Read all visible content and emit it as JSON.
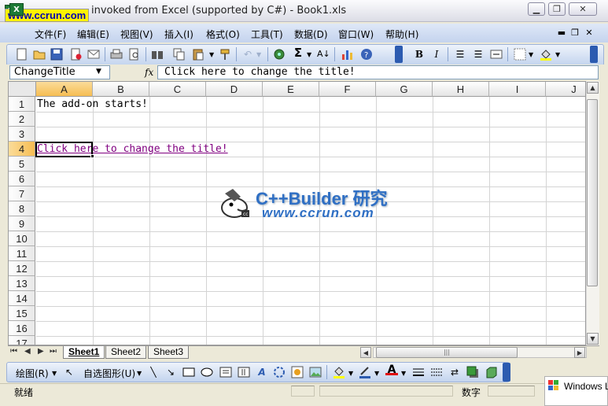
{
  "window": {
    "title": "invoked from Excel (supported by C#) - Book1.xls",
    "watermark_corner": "www.ccrun.com",
    "app_icon_letter": "X",
    "buttons": {
      "minimize": "▁",
      "restore": "❐",
      "close": "✕"
    }
  },
  "menu": {
    "items": [
      "文件(F)",
      "编辑(E)",
      "视图(V)",
      "插入(I)",
      "格式(O)",
      "工具(T)",
      "数据(D)",
      "窗口(W)",
      "帮助(H)"
    ],
    "mdi": {
      "minimize": "▬",
      "restore": "❐",
      "close": "✕"
    }
  },
  "formula_bar": {
    "name_box": "ChangeTitle",
    "fx": "fx",
    "content": "Click here to change the title!"
  },
  "grid": {
    "columns": [
      "A",
      "B",
      "C",
      "D",
      "E",
      "F",
      "G",
      "H",
      "I",
      "J"
    ],
    "rows": [
      "1",
      "2",
      "3",
      "4",
      "5",
      "6",
      "7",
      "8",
      "9",
      "10",
      "11",
      "12",
      "13",
      "14",
      "15",
      "16",
      "17"
    ],
    "active_column": "A",
    "active_row": "4",
    "cells": {
      "A1": "The add-on starts!",
      "A4": "Click here to change the title!"
    },
    "hyperlink_color": "#800080"
  },
  "sheets": {
    "tabs": [
      "Sheet1",
      "Sheet2",
      "Sheet3"
    ],
    "active": "Sheet1",
    "nav": [
      "⏮",
      "◀",
      "▶",
      "⏭"
    ]
  },
  "drawing_toolbar": {
    "draw_label": "绘图(R)",
    "autoshapes_label": "自选图形(U)"
  },
  "status": {
    "ready": "就绪",
    "num": "数字"
  },
  "notification": {
    "label": "Windows L"
  },
  "watermark": {
    "title": "C++Builder 研究",
    "url": "www.ccrun.com"
  },
  "colors": {
    "accent": "#2f6fc4",
    "selected_header": "#f6bd52"
  }
}
